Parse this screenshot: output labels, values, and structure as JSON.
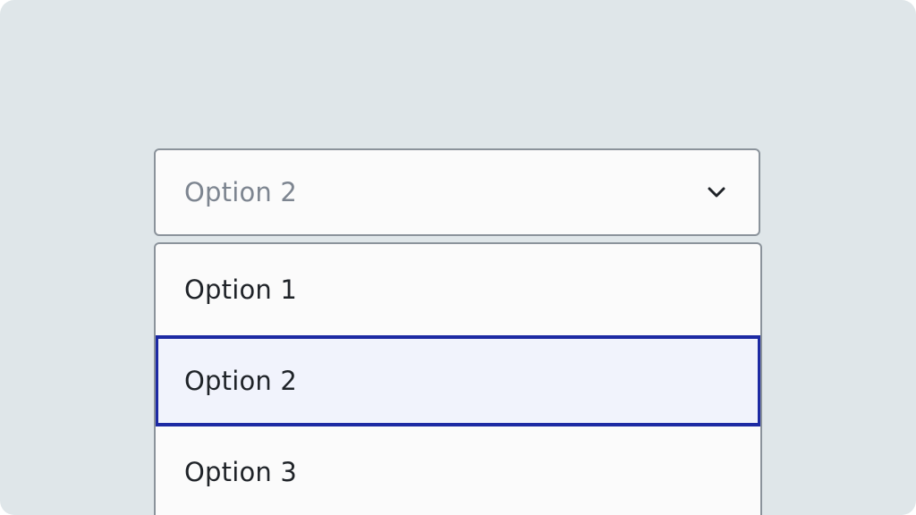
{
  "select": {
    "value": "Option 2",
    "icon": "chevron-down-icon"
  },
  "options": [
    {
      "label": "Option 1",
      "selected": false
    },
    {
      "label": "Option 2",
      "selected": true
    },
    {
      "label": "Option 3",
      "selected": false
    }
  ],
  "colors": {
    "background": "#dfe6e9",
    "border": "#8b939b",
    "selected_border": "#1d2aa3",
    "selected_fill": "#f1f3fc"
  }
}
